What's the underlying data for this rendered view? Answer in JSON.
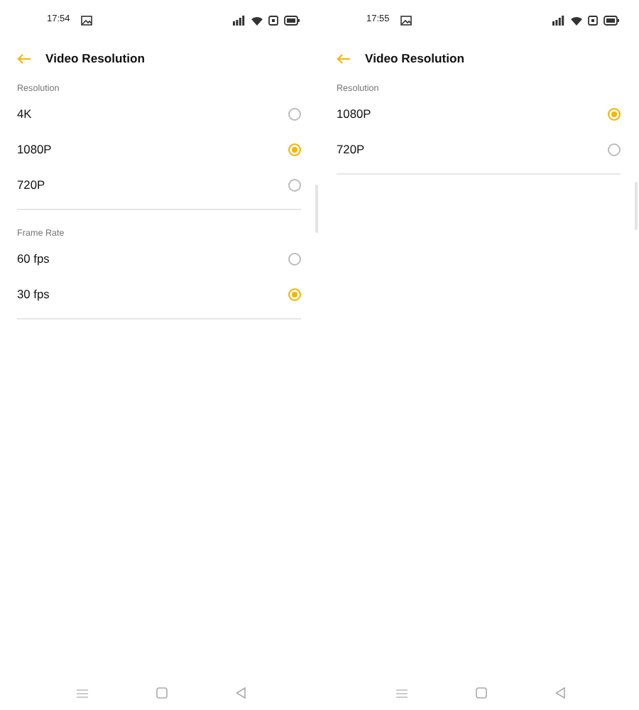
{
  "screens": [
    {
      "time": "17:54",
      "title": "Video Resolution",
      "sections": [
        {
          "heading": "Resolution",
          "options": [
            {
              "label": "4K",
              "selected": false
            },
            {
              "label": "1080P",
              "selected": true
            },
            {
              "label": "720P",
              "selected": false
            }
          ]
        },
        {
          "heading": "Frame Rate",
          "options": [
            {
              "label": "60 fps",
              "selected": false
            },
            {
              "label": "30 fps",
              "selected": true
            }
          ]
        }
      ]
    },
    {
      "time": "17:55",
      "title": "Video Resolution",
      "sections": [
        {
          "heading": "Resolution",
          "options": [
            {
              "label": "1080P",
              "selected": true
            },
            {
              "label": "720P",
              "selected": false
            }
          ]
        }
      ]
    }
  ]
}
